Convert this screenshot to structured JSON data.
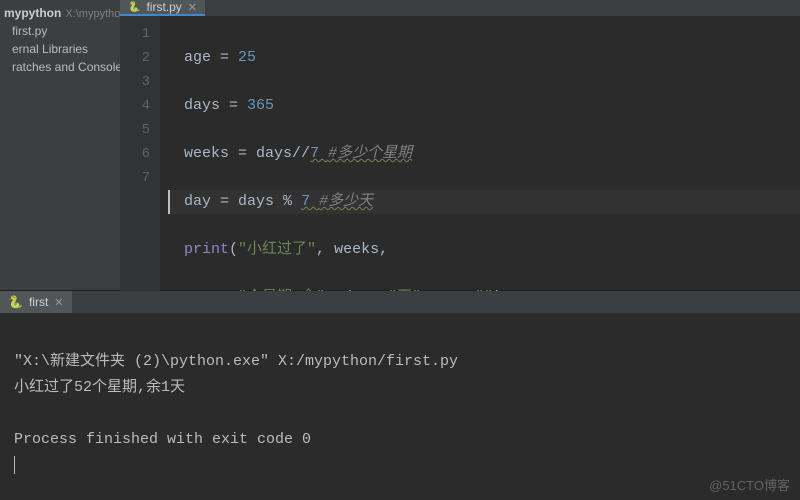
{
  "editor_tab": {
    "label": "first.py",
    "icon": "🐍"
  },
  "sidebar": {
    "project_name": "mypython",
    "project_path": "X:\\mypython",
    "items": [
      "first.py",
      "ernal Libraries",
      "ratches and Consoles"
    ]
  },
  "gutter": [
    "1",
    "2",
    "3",
    "4",
    "5",
    "6",
    "7"
  ],
  "code": {
    "l1": {
      "a": "age",
      "op": " = ",
      "n": "25"
    },
    "l2": {
      "a": "days",
      "op": " = ",
      "n": "365"
    },
    "l3": {
      "a": "weeks",
      "op": " = ",
      "b": "days",
      "op2": "//",
      "n": "7 ",
      "c": "#多少个星期"
    },
    "l4": {
      "a": "day",
      "op": " = ",
      "b": "days",
      "op2": " % ",
      "n": "7 ",
      "c": "#多少天"
    },
    "l5": {
      "fn": "print",
      "p": "(",
      "s1": "\"小红过了\"",
      "cma": ", ",
      "id": "weeks",
      "tr": ","
    },
    "l6": {
      "pad": "      ",
      "s1": "\"个星期,余\"",
      "c1": ", ",
      "id": "day",
      "c2": ", ",
      "s2": "\"天\"",
      "c3": ", ",
      "kw": "sep",
      "eq": "=",
      "s3": "\"\"",
      "p": ")"
    }
  },
  "run_tab": {
    "label": "first",
    "icon": "🐍"
  },
  "console": {
    "line1": "\"X:\\新建文件夹 (2)\\python.exe\" X:/mypython/first.py",
    "line2": "小红过了52个星期,余1天",
    "blank": "",
    "line3": "Process finished with exit code 0"
  },
  "watermark": "@51CTO博客"
}
